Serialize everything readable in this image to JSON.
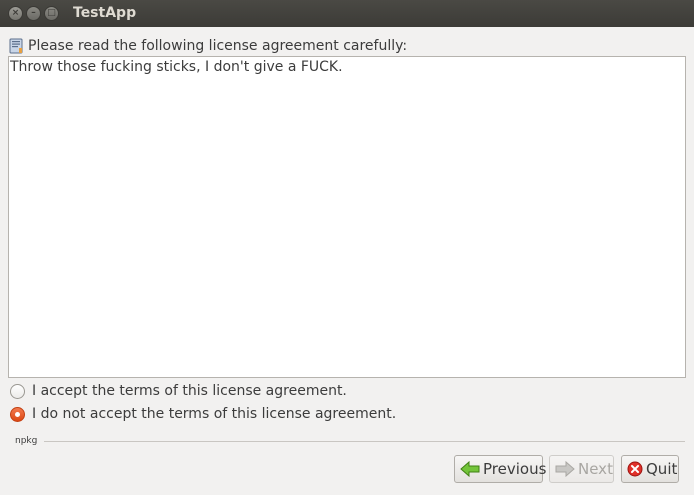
{
  "window": {
    "title": "TestApp"
  },
  "header": {
    "text": "Please read the following license agreement carefully:"
  },
  "license": {
    "text": "Throw those fucking sticks, I don't give a FUCK."
  },
  "options": [
    {
      "label": "I accept the terms of this license agreement.",
      "checked": false
    },
    {
      "label": "I do not accept the terms of this license agreement.",
      "checked": true
    }
  ],
  "footer": {
    "separator_label": "npkg"
  },
  "buttons": {
    "previous": "Previous",
    "next": "Next",
    "quit": "Quit"
  },
  "icons": {
    "close": "close-icon",
    "minimize": "minimize-icon",
    "maximize": "maximize-icon",
    "header": "document-icon",
    "previous": "arrow-left-icon",
    "next": "arrow-right-icon",
    "quit": "quit-icon"
  },
  "colors": {
    "titlebar": "#3c3b37",
    "radio_selected": "#dd4814",
    "previous_arrow": "#4e9a06",
    "quit_icon": "#cc0000"
  }
}
